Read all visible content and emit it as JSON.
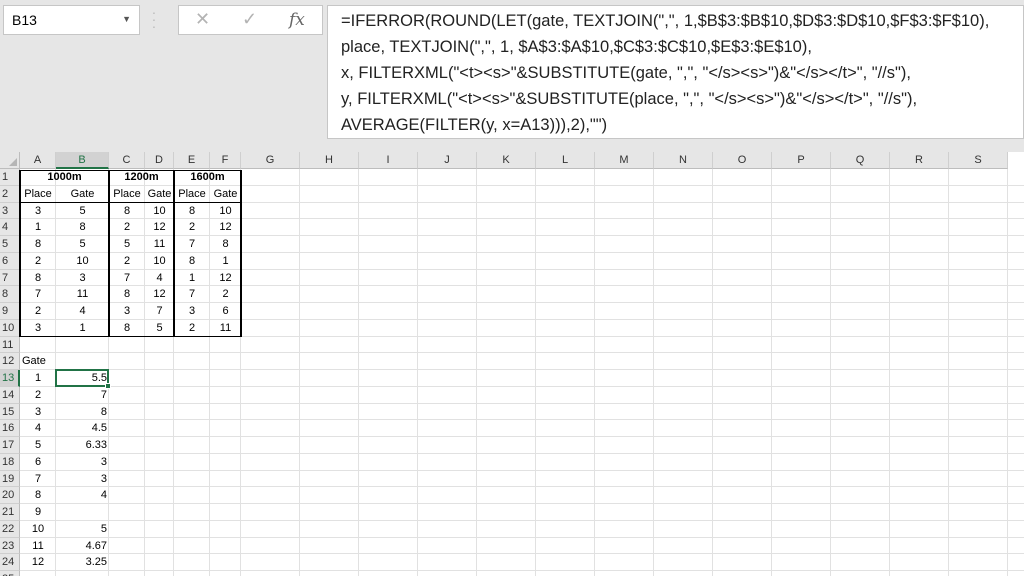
{
  "formula_bar": {
    "name_box": "B13",
    "cancel_icon": "cancel-x-icon",
    "enter_icon": "enter-check-icon",
    "function_icon": "fx-icon",
    "formula_lines": [
      "=IFERROR(ROUND(LET(gate, TEXTJOIN(\",\", 1,$B$3:$B$10,$D$3:$D$10,$F$3:$F$10),",
      "place, TEXTJOIN(\",\", 1, $A$3:$A$10,$C$3:$C$10,$E$3:$E$10),",
      "x, FILTERXML(\"<t><s>\"&SUBSTITUTE(gate, \",\", \"</s><s>\")&\"</s></t>\", \"//s\"),",
      "y, FILTERXML(\"<t><s>\"&SUBSTITUTE(place, \",\", \"</s><s>\")&\"</s></t>\", \"//s\"),",
      "AVERAGE(FILTER(y, x=A13))),2),\"\")"
    ]
  },
  "sheet": {
    "selected_cell": "B13",
    "column_headers": [
      "A",
      "B",
      "C",
      "D",
      "E",
      "F",
      "G",
      "H",
      "I",
      "J",
      "K",
      "L",
      "M",
      "N",
      "O",
      "P",
      "Q",
      "R",
      "S"
    ],
    "row_headers": [
      "1",
      "2",
      "3",
      "4",
      "5",
      "6",
      "7",
      "8",
      "9",
      "10",
      "11",
      "12",
      "13",
      "14",
      "15",
      "16",
      "17",
      "18",
      "19",
      "20",
      "21",
      "22",
      "23",
      "24",
      "25"
    ],
    "distance_headers": [
      "1000m",
      "1200m",
      "1600m"
    ],
    "sub_headers": [
      "Place",
      "Gate",
      "Place",
      "Gate",
      "Place",
      "Gate"
    ],
    "race_rows": [
      [
        "3",
        "5",
        "8",
        "10",
        "8",
        "10"
      ],
      [
        "1",
        "8",
        "2",
        "12",
        "2",
        "12"
      ],
      [
        "8",
        "5",
        "5",
        "11",
        "7",
        "8"
      ],
      [
        "2",
        "10",
        "2",
        "10",
        "8",
        "1"
      ],
      [
        "8",
        "3",
        "7",
        "4",
        "1",
        "12"
      ],
      [
        "7",
        "11",
        "8",
        "12",
        "7",
        "2"
      ],
      [
        "2",
        "4",
        "3",
        "7",
        "3",
        "6"
      ],
      [
        "3",
        "1",
        "8",
        "5",
        "2",
        "11"
      ]
    ],
    "summary_header": "Gate",
    "summary_rows": [
      [
        "1",
        "5.5"
      ],
      [
        "2",
        "7"
      ],
      [
        "3",
        "8"
      ],
      [
        "4",
        "4.5"
      ],
      [
        "5",
        "6.33"
      ],
      [
        "6",
        "3"
      ],
      [
        "7",
        "3"
      ],
      [
        "8",
        "4"
      ],
      [
        "9",
        ""
      ],
      [
        "10",
        "5"
      ],
      [
        "11",
        "4.67"
      ],
      [
        "12",
        "3.25"
      ]
    ]
  }
}
